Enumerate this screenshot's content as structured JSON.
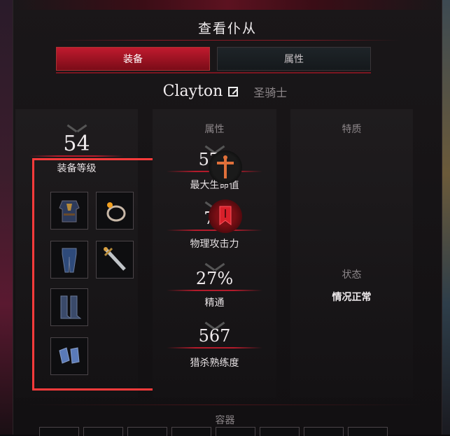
{
  "window": {
    "title": "查看仆从"
  },
  "tabs": [
    {
      "label": "装备",
      "active": true
    },
    {
      "label": "属性",
      "active": false
    }
  ],
  "character": {
    "name": "Clayton",
    "class": "圣骑士"
  },
  "equipment": {
    "level_value": "54",
    "level_label": "装备等级",
    "slots": [
      {
        "icon": "chest-armor-icon"
      },
      {
        "icon": "ring-icon"
      },
      {
        "icon": "pants-icon"
      },
      {
        "icon": "sword-icon"
      },
      {
        "icon": "boots-icon"
      },
      {
        "icon": "gloves-icon"
      }
    ]
  },
  "attributes": {
    "header": "属性",
    "items": [
      {
        "value": "573",
        "label": "最大生命值"
      },
      {
        "value": "75",
        "label": "物理攻击力"
      },
      {
        "value": "27%",
        "label": "精通"
      },
      {
        "value": "567",
        "label": "猎杀熟练度"
      }
    ]
  },
  "traits": {
    "header": "特质",
    "icons": [
      "cross-emblem-icon",
      "red-banner-icon"
    ],
    "status_header": "状态",
    "status_value": "情况正常"
  },
  "container": {
    "label": "容器"
  },
  "colors": {
    "accent": "#b31b2b",
    "highlight_box": "#ff3b3b",
    "tab_active": "#c01a2e"
  }
}
